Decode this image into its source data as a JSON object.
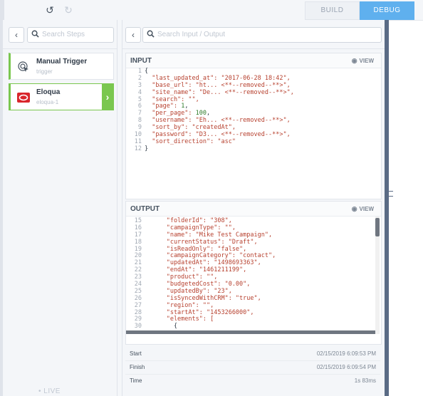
{
  "toolbar": {
    "undo_icon": "undo-icon",
    "redo_icon": "redo-icon",
    "build_label": "BUILD",
    "debug_label": "DEBUG",
    "active_tab": "DEBUG"
  },
  "steps_panel": {
    "search_placeholder": "Search Steps",
    "steps": [
      {
        "title": "Manual Trigger",
        "subtitle": "trigger",
        "icon": "pointer-icon"
      },
      {
        "title": "Eloqua",
        "subtitle": "eloqua-1",
        "icon": "eloqua-logo-icon"
      }
    ],
    "live_label": "LIVE"
  },
  "debug_panel": {
    "search_placeholder": "Search Input / Output",
    "input": {
      "title": "INPUT",
      "view_label": "VIEW",
      "lines": [
        {
          "n": "1",
          "t": "{"
        },
        {
          "n": "2",
          "t": "  \"last_updated_at\": \"2017-06-28 18:42\","
        },
        {
          "n": "3",
          "t": "  \"base_url\": \"ht... <**--removed--**>\","
        },
        {
          "n": "4",
          "t": "  \"site_name\": \"De... <**--removed--**>\","
        },
        {
          "n": "5",
          "t": "  \"search\": \"\","
        },
        {
          "n": "6",
          "t": "  \"page\": 1,"
        },
        {
          "n": "7",
          "t": "  \"per_page\": 100,"
        },
        {
          "n": "8",
          "t": "  \"username\": \"Eh... <**--removed--**>\","
        },
        {
          "n": "9",
          "t": "  \"sort_by\": \"createdAt\","
        },
        {
          "n": "10",
          "t": "  \"password\": \"D3... <**--removed--**>\","
        },
        {
          "n": "11",
          "t": "  \"sort_direction\": \"asc\""
        },
        {
          "n": "12",
          "t": "}"
        }
      ]
    },
    "output": {
      "title": "OUTPUT",
      "view_label": "VIEW",
      "lines": [
        {
          "n": "15",
          "t": "      \"folderId\": \"308\","
        },
        {
          "n": "16",
          "t": "      \"campaignType\": \"\","
        },
        {
          "n": "17",
          "t": "      \"name\": \"Mike Test Campaign\","
        },
        {
          "n": "18",
          "t": "      \"currentStatus\": \"Draft\","
        },
        {
          "n": "19",
          "t": "      \"isReadOnly\": \"false\","
        },
        {
          "n": "20",
          "t": "      \"campaignCategory\": \"contact\","
        },
        {
          "n": "21",
          "t": "      \"updatedAt\": \"1498693363\","
        },
        {
          "n": "22",
          "t": "      \"endAt\": \"1461211199\","
        },
        {
          "n": "23",
          "t": "      \"product\": \"\","
        },
        {
          "n": "24",
          "t": "      \"budgetedCost\": \"0.00\","
        },
        {
          "n": "25",
          "t": "      \"updatedBy\": \"23\","
        },
        {
          "n": "26",
          "t": "      \"isSyncedWithCRM\": \"true\","
        },
        {
          "n": "27",
          "t": "      \"region\": \"\","
        },
        {
          "n": "28",
          "t": "      \"startAt\": \"1453266000\","
        },
        {
          "n": "29",
          "t": "      \"elements\": ["
        },
        {
          "n": "30",
          "t": "        {"
        }
      ]
    },
    "timing": {
      "start_label": "Start",
      "start_value": "02/15/2019 6:09:53 PM",
      "finish_label": "Finish",
      "finish_value": "02/15/2019 6:09:54 PM",
      "time_label": "Time",
      "time_value": "1s 83ms"
    }
  }
}
